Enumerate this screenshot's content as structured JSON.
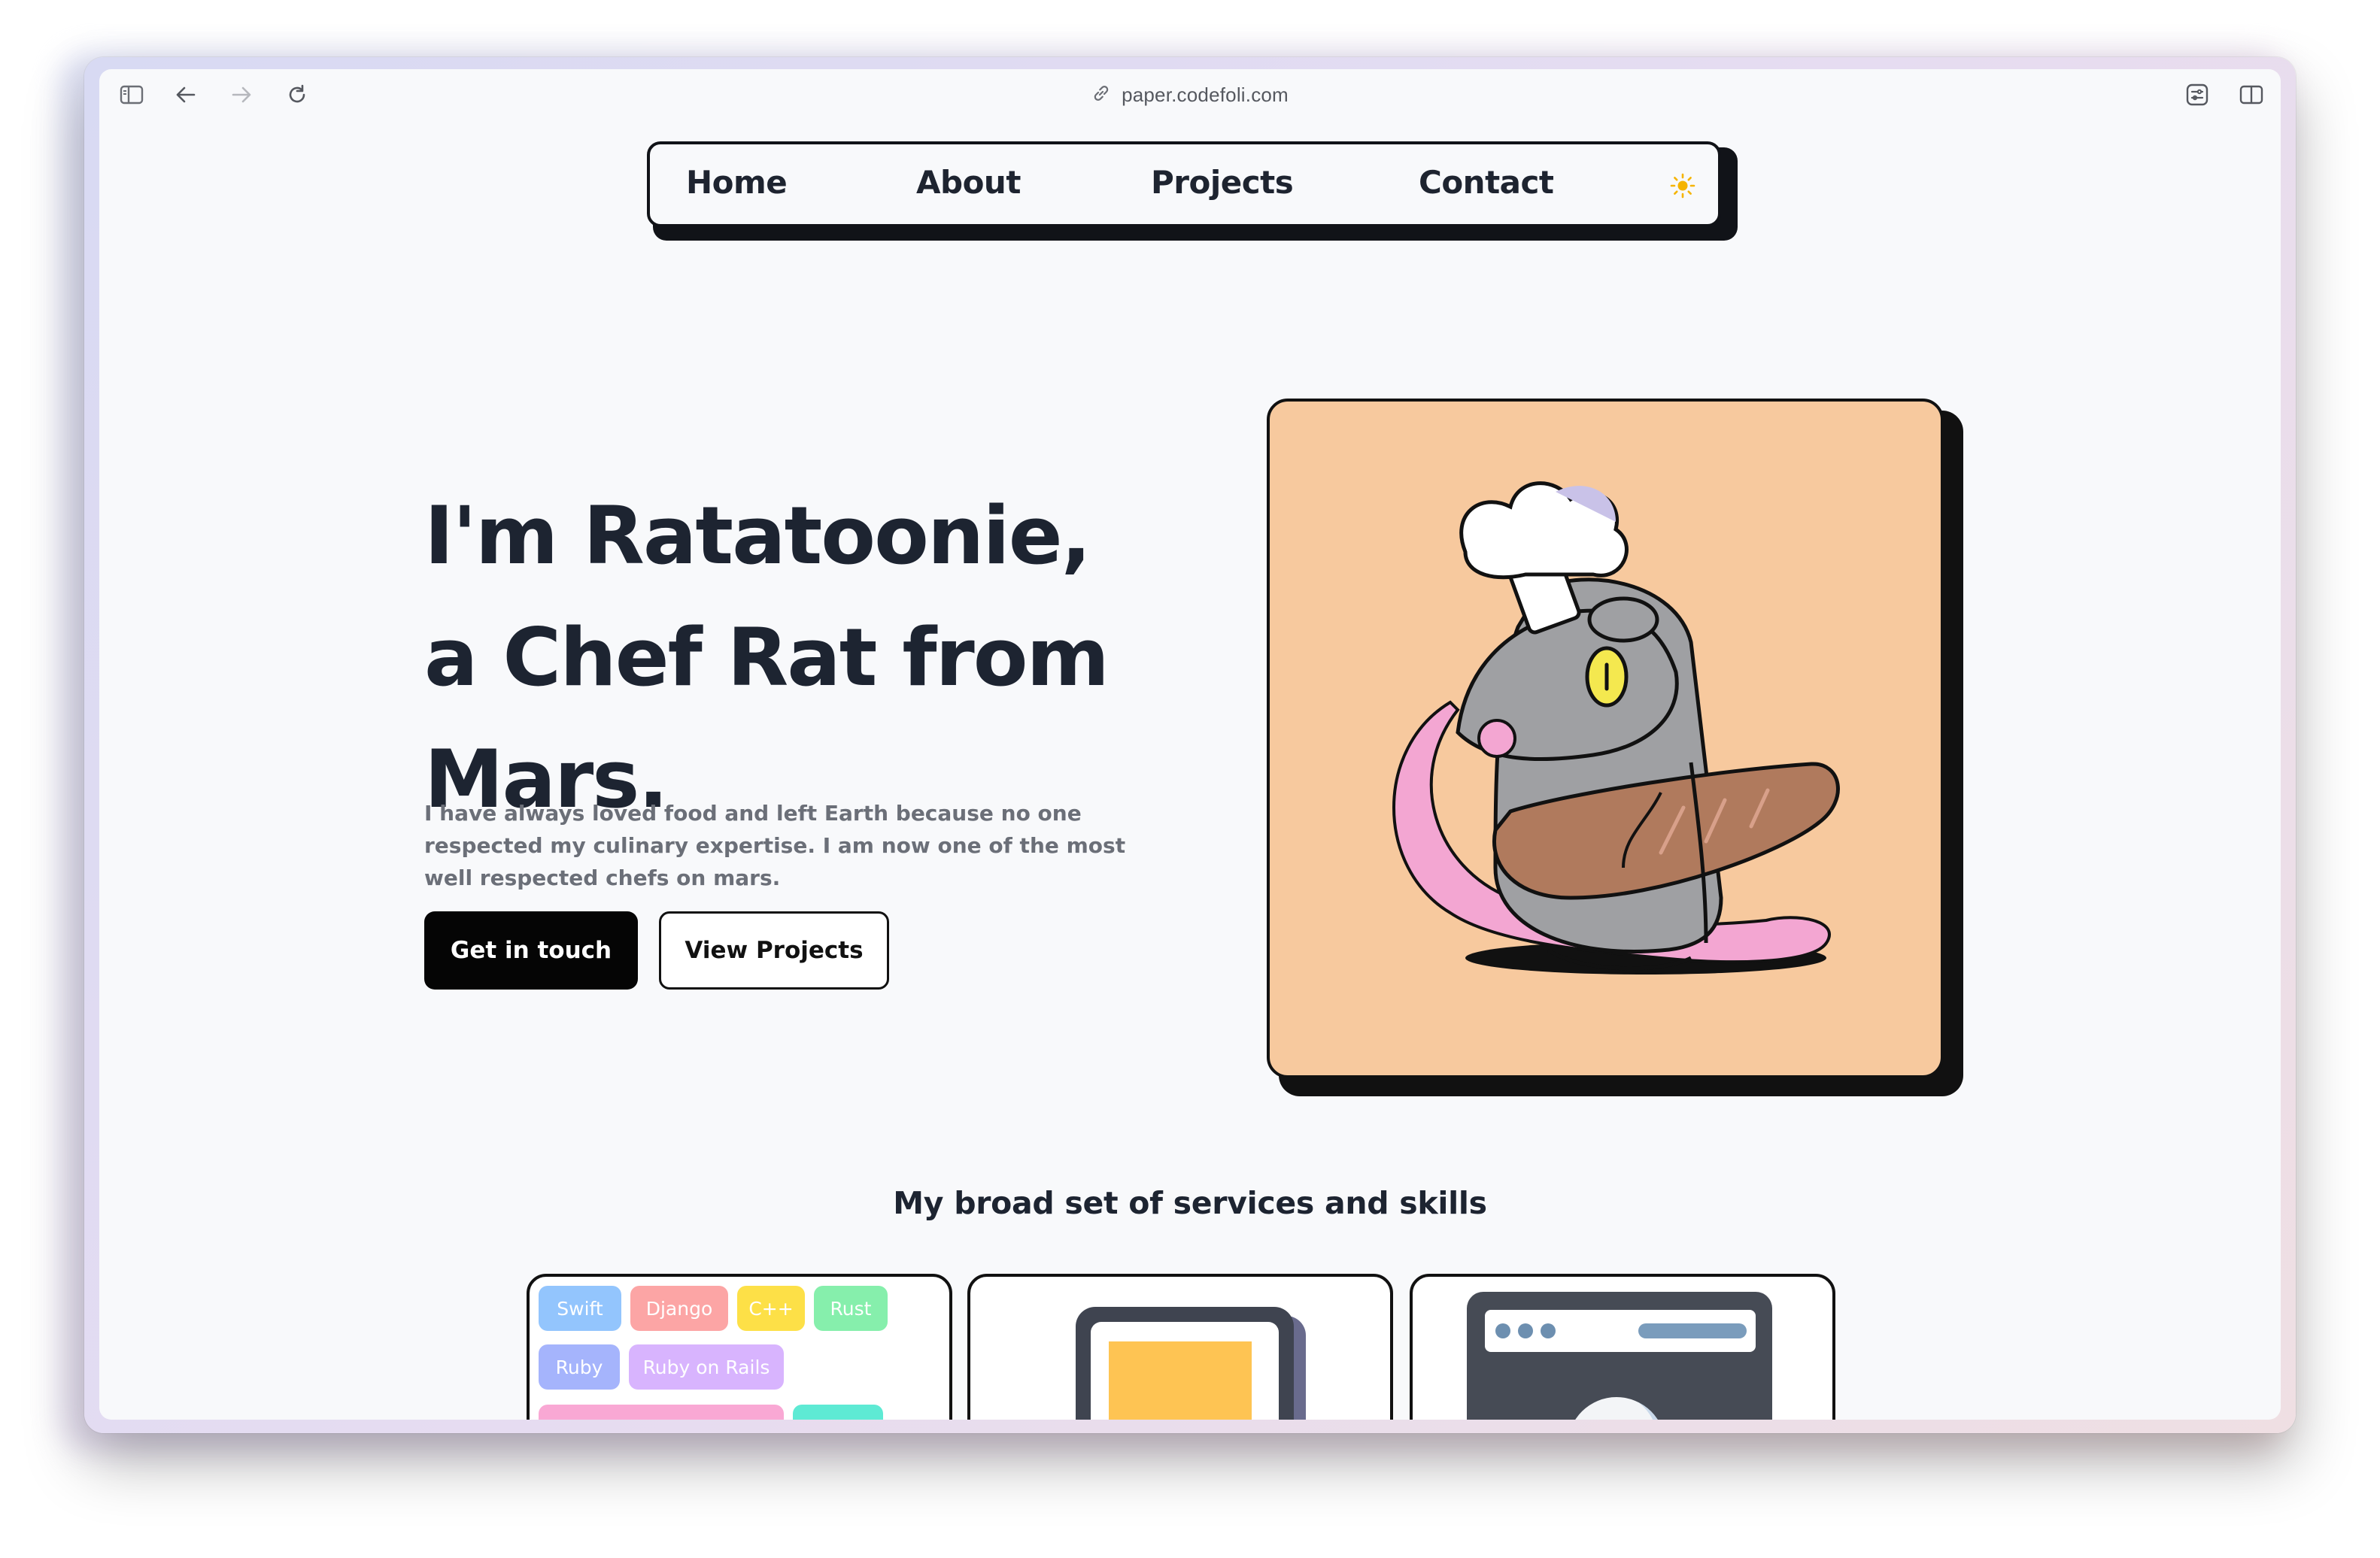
{
  "browser": {
    "url": "paper.codefoli.com"
  },
  "nav": {
    "links": [
      "Home",
      "About",
      "Projects",
      "Contact"
    ],
    "theme_toggle": "sun-icon"
  },
  "hero": {
    "title": "I'm Ratatoonie, a Chef Rat from Mars.",
    "subtitle": "I have always loved food and left Earth because no one respected my culinary expertise. I am now one of the most well respected chefs on mars.",
    "primary_button": "Get in touch",
    "secondary_button": "View Projects",
    "image_bg": "#f7c99e"
  },
  "services": {
    "title": "My broad set of services and skills",
    "skills": [
      {
        "label": "Swift",
        "color": "#93c5fd"
      },
      {
        "label": "Django",
        "color": "#fca5a5"
      },
      {
        "label": "C++",
        "color": "#fde047"
      },
      {
        "label": "Rust",
        "color": "#86efac"
      },
      {
        "label": "Ruby",
        "color": "#a5b4fc"
      },
      {
        "label": "Ruby on Rails",
        "color": "#d8b4fe"
      }
    ]
  }
}
